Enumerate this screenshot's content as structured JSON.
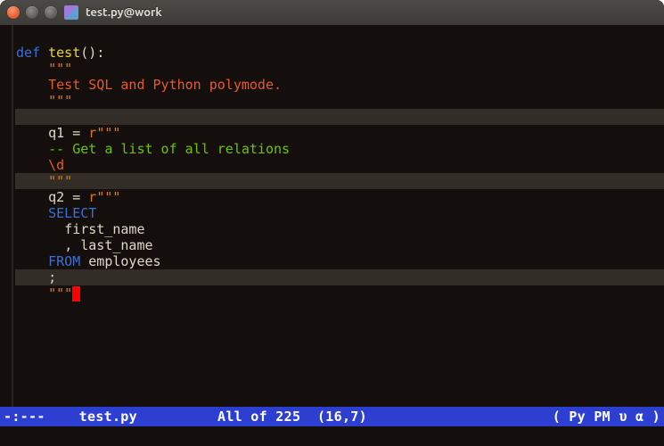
{
  "titlebar": {
    "title": "test.py@work"
  },
  "code": {
    "l1": {
      "def": "def",
      "fn": "test",
      "parens": "()",
      "colon": ":"
    },
    "l2": {
      "tri": "\"\"\""
    },
    "l3": {
      "txt": "Test SQL and Python polymode."
    },
    "l4": {
      "tri": "\"\"\""
    },
    "l5": "",
    "l6": {
      "var": "q1",
      "eq": " = ",
      "pre": "r",
      "tri": "\"\"\""
    },
    "l7": {
      "cmt": "-- Get a list of all relations"
    },
    "l8": {
      "txt": "\\d"
    },
    "l9": {
      "tri": "\"\"\""
    },
    "l10": {
      "var": "q2",
      "eq": " = ",
      "pre": "r",
      "tri": "\"\"\""
    },
    "l11": {
      "kw": "SELECT"
    },
    "l12": {
      "id": "first_name"
    },
    "l13": {
      "comma": ", ",
      "id": "last_name"
    },
    "l14": {
      "kw": "FROM",
      "id": " employees"
    },
    "l15": {
      "semi": ";"
    },
    "l16": {
      "tri": "\"\"\""
    }
  },
  "modeline": {
    "left": "-:---",
    "file": "test.py",
    "pos_all": "All of 225",
    "pos_rc": "(16,7)",
    "modes": "( Py PM  υ  α )"
  }
}
